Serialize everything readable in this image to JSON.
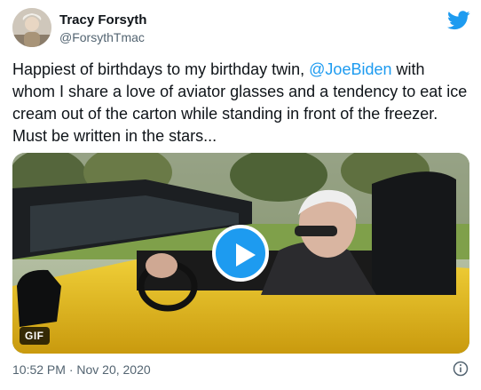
{
  "tweet": {
    "author_name": "Tracy Forsyth",
    "author_handle": "@ForsythTmac",
    "text_before": "Happiest of birthdays to my birthday twin, ",
    "mention": "@JoeBiden",
    "text_after": " with whom I share a love of aviator glasses and a tendency to eat ice cream out of the carton while standing in front of the freezer. Must be written in the stars...",
    "media_badge": "GIF",
    "timestamp": "10:52 PM · Nov 20, 2020"
  },
  "icons": {
    "brand": "twitter-bird-icon",
    "play": "play-icon",
    "info": "info-icon"
  },
  "colors": {
    "accent": "#1d9bf0",
    "text": "#0f1419",
    "muted": "#536471",
    "car": "#e8c21c"
  }
}
